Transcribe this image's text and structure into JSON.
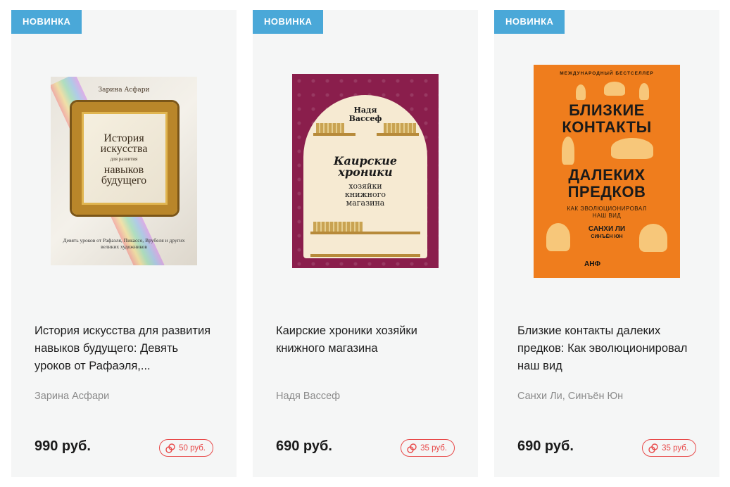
{
  "products": [
    {
      "badge": "НОВИНКА",
      "cover": {
        "author": "Зарина Асфари",
        "title_line1": "История",
        "title_line2": "искусства",
        "title_small": "для развития",
        "title_line3": "навыков",
        "title_line4": "будущего",
        "subtitle": "Девять уроков от Рафаэля, Пикассо, Врубеля и других великих художников"
      },
      "title": "История искусства для развития навыков будущего: Девять уроков от Рафаэля,...",
      "author": "Зарина Асфари",
      "price": "990 руб.",
      "bonus": "50 руб."
    },
    {
      "badge": "НОВИНКА",
      "cover": {
        "author_line1": "Надя",
        "author_line2": "Вассеф",
        "title_line1": "Каирские",
        "title_line2": "хроники",
        "sub_line1": "хозяйки",
        "sub_line2": "книжного",
        "sub_line3": "магазина"
      },
      "title": "Каирские хроники хозяйки книжного магазина",
      "author": "Надя Вассеф",
      "price": "690 руб.",
      "bonus": "35 руб."
    },
    {
      "badge": "НОВИНКА",
      "cover": {
        "top": "МЕЖДУНАРОДНЫЙ БЕСТСЕЛЛЕР",
        "line1": "БЛИЗКИЕ",
        "line2": "КОНТАКТЫ",
        "line3": "ДАЛЕКИХ",
        "line4": "ПРЕДКОВ",
        "mid_line1": "КАК ЭВОЛЮЦИОНИРОВАЛ",
        "mid_line2": "НАШ ВИД",
        "auth_line1": "САНХИ ЛИ",
        "auth_line2": "СИНЪЁН ЮН",
        "publisher": "АНФ"
      },
      "title": "Близкие контакты далеких предков: Как эволюционировал наш вид",
      "author": "Санхи Ли, Синъён Юн",
      "price": "690 руб.",
      "bonus": "35 руб."
    }
  ],
  "colors": {
    "badge": "#4aa8d8",
    "card_bg": "#f5f6f6",
    "bonus": "#e84a4a",
    "author": "#8b8b8b"
  },
  "icons": {
    "bonus": "bonus-coin-icon"
  }
}
